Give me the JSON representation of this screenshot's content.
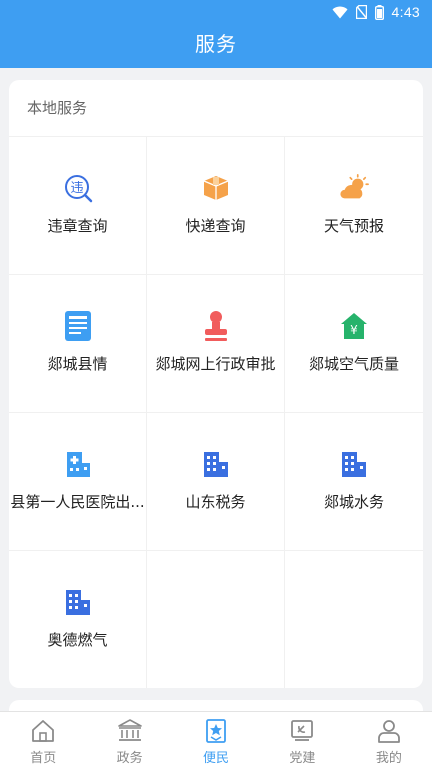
{
  "status_bar": {
    "time": "4:43"
  },
  "header": {
    "title": "服务"
  },
  "local_services": {
    "title": "本地服务",
    "items": [
      {
        "label": "违章查询",
        "icon": "violation-query-icon"
      },
      {
        "label": "快递查询",
        "icon": "parcel-box-icon"
      },
      {
        "label": "天气预报",
        "icon": "weather-sun-cloud-icon"
      },
      {
        "label": "郯城县情",
        "icon": "document-icon"
      },
      {
        "label": "郯城网上行政审批",
        "icon": "stamp-icon"
      },
      {
        "label": "郯城空气质量",
        "icon": "air-quality-house-icon"
      },
      {
        "label": "县第一人民医院出...",
        "icon": "hospital-building-icon"
      },
      {
        "label": "山东税务",
        "icon": "office-building-icon"
      },
      {
        "label": "郯城水务",
        "icon": "office-building-icon"
      },
      {
        "label": "奥德燃气",
        "icon": "office-building-icon"
      }
    ]
  },
  "tabbar": {
    "tabs": [
      {
        "label": "首页",
        "icon": "home-icon"
      },
      {
        "label": "政务",
        "icon": "government-building-icon"
      },
      {
        "label": "便民",
        "icon": "star-bookmark-icon",
        "active": true
      },
      {
        "label": "党建",
        "icon": "party-flag-icon"
      },
      {
        "label": "我的",
        "icon": "user-icon"
      }
    ]
  },
  "colors": {
    "primary": "#3e9ef2",
    "orange": "#f5a24a",
    "red": "#f15c5c",
    "green": "#26b36b",
    "blue": "#3a6fe0"
  }
}
